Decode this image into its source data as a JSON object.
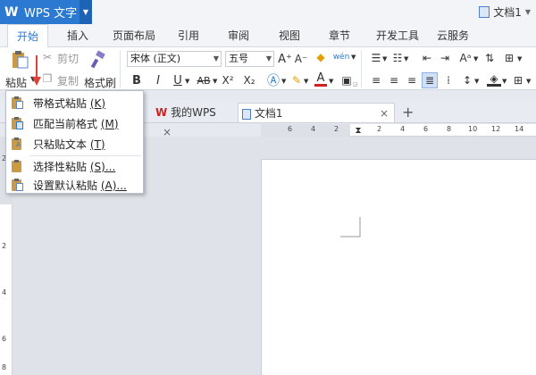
{
  "app": {
    "name": "WPS 文字",
    "logo": "W",
    "document_title": "文档1"
  },
  "tabs": [
    {
      "label": "开始",
      "active": true
    },
    {
      "label": "插入"
    },
    {
      "label": "页面布局"
    },
    {
      "label": "引用"
    },
    {
      "label": "审阅"
    },
    {
      "label": "视图"
    },
    {
      "label": "章节"
    },
    {
      "label": "开发工具"
    },
    {
      "label": "云服务"
    }
  ],
  "ribbon": {
    "paste_label": "粘贴",
    "cut_label": "剪切",
    "copy_label": "复制",
    "format_painter_label": "格式刷",
    "font_name": "宋体 (正文)",
    "font_size": "五号",
    "bold": "B",
    "italic": "I",
    "underline": "U",
    "strike": "AB",
    "superscript": "X²",
    "subscript": "X₂",
    "font_color": "A",
    "grow_font": "A⁺",
    "shrink_font": "A⁻",
    "phonetic": "wén"
  },
  "paste_menu": {
    "items": [
      {
        "label": "带格式粘贴",
        "shortcut": "(K)"
      },
      {
        "label": "匹配当前格式",
        "shortcut": "(M)"
      },
      {
        "label": "只粘贴文本",
        "shortcut": "(T)"
      },
      {
        "label": "选择性粘贴",
        "shortcut": "(S)..."
      },
      {
        "label": "设置默认粘贴",
        "shortcut": "(A)..."
      }
    ]
  },
  "doc_tabs": [
    {
      "label": "我的WPS"
    },
    {
      "label": "文档1",
      "active": true
    }
  ],
  "ruler": {
    "h_ticks": [
      "6",
      "4",
      "2",
      "2",
      "4",
      "6",
      "8",
      "10",
      "12",
      "14"
    ],
    "v_ticks": [
      "2",
      "2",
      "4",
      "6",
      "8"
    ]
  },
  "colors": {
    "accent": "#2b79d1",
    "annotation_arrow": "#e0403a"
  }
}
